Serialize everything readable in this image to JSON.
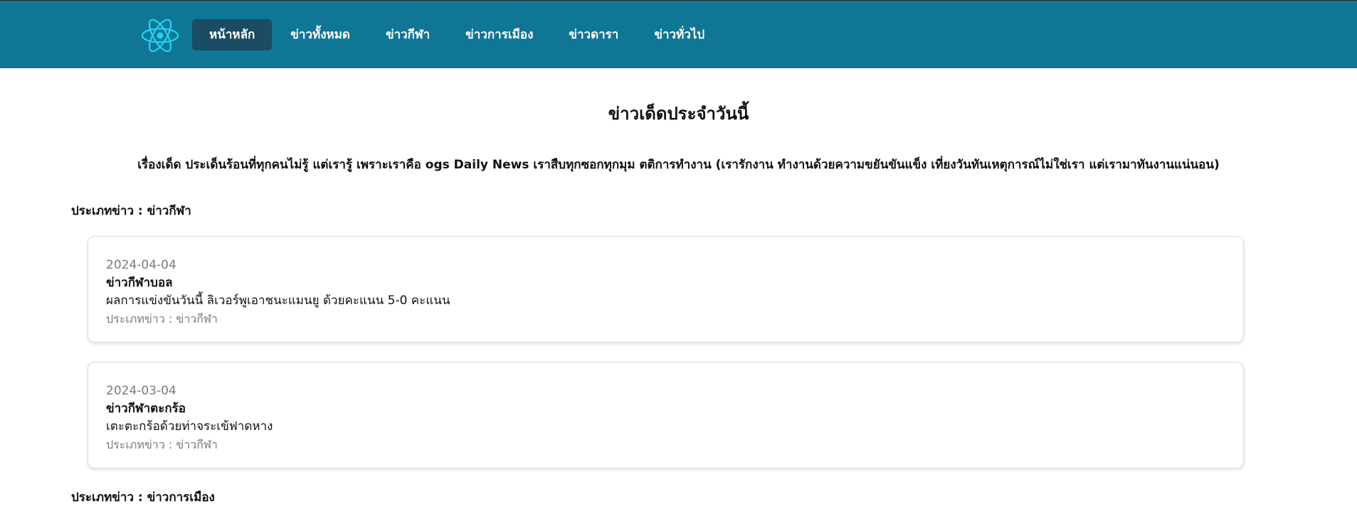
{
  "colors": {
    "nav_bg": "#107696",
    "nav_active": "#1a4c63",
    "logo_color": "#21d4f5"
  },
  "nav": {
    "logo_icon": "react-atom-icon",
    "items": [
      {
        "label": "หน้าหลัก",
        "active": true
      },
      {
        "label": "ข่าวทั้งหมด"
      },
      {
        "label": "ข่าวกีฬา"
      },
      {
        "label": "ข่าวการเมือง"
      },
      {
        "label": "ข่าวดารา"
      },
      {
        "label": "ข่าวทั่วไป"
      }
    ]
  },
  "main": {
    "title": "ข่าวเด็ดประจำวันนี้",
    "intro": "เรื่องเด็ด ประเด็นร้อนที่ทุกคนไม่รู้ แต่เรารู้ เพราะเราคือ ogs Daily News เราสืบทุกซอกทุกมุม ตติการทำงาน (เรารักงาน ทำงานด้วยความขยันขันแข็ง เที่ยงวันทันเหตุการณ์ไม่ใช่เรา แต่เรามาทันงานแน่นอน)",
    "sections": [
      {
        "heading": "ประเภทข่าว : ข่าวกีฬา",
        "cards": [
          {
            "date": "2024-04-04",
            "title": "ข่าวกีฬาบอล",
            "body": "ผลการแข่งขันวันนี้ ลิเวอร์พูเอาชนะแมนยู ด้วยคะแนน 5-0 คะแนน",
            "type": "ประเภทข่าว : ข่าวกีฬา"
          },
          {
            "date": "2024-03-04",
            "title": "ข่าวกีฬาตะกร้อ",
            "body": "เตะตะกร้อด้วยท่าจระเข้ฟาดหาง",
            "type": "ประเภทข่าว : ข่าวกีฬา"
          }
        ]
      },
      {
        "heading": "ประเภทข่าว : ข่าวการเมือง",
        "cards": []
      }
    ]
  }
}
